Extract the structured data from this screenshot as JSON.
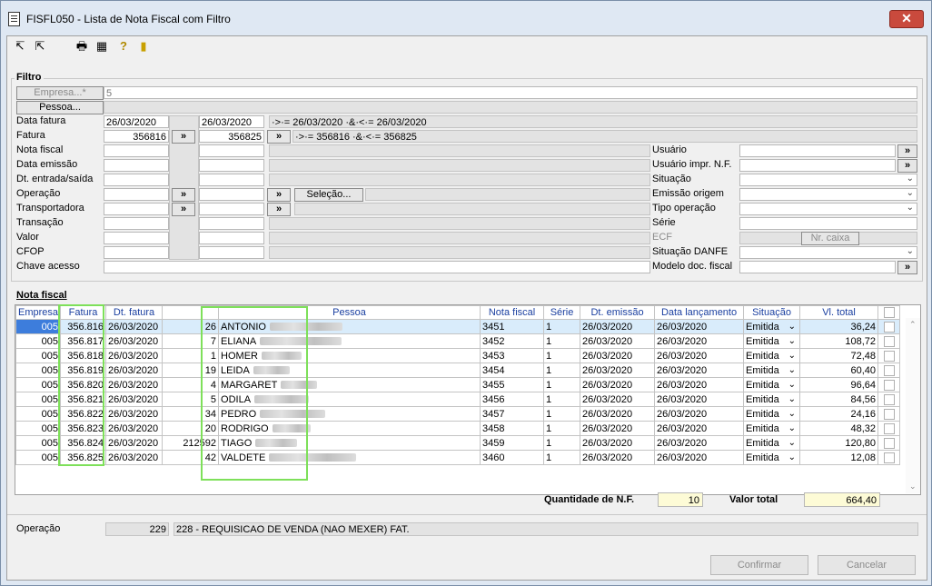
{
  "window": {
    "title": "FISFL050 - Lista de Nota Fiscal com Filtro",
    "close": "✕"
  },
  "toolbar": [
    "↸",
    "⇱",
    "🖶",
    "▦",
    "?",
    "▮"
  ],
  "filtro": {
    "title": "Filtro",
    "empresa_btn": "Empresa...*",
    "empresa_value": "5",
    "pessoa_btn": "Pessoa...",
    "data_fatura_label": "Data fatura",
    "data_fatura_from": "26/03/2020",
    "data_fatura_to": "26/03/2020",
    "data_fatura_expr": "·>·= 26/03/2020 ·&·<·= 26/03/2020",
    "fatura_label": "Fatura",
    "fatura_from": "356816",
    "fatura_to": "356825",
    "fatura_expr": "·>·= 356816 ·&·<·= 356825",
    "arrow": "»",
    "nota_fiscal_label": "Nota fiscal",
    "data_emissao_label": "Data emissão",
    "dt_entrada_label": "Dt. entrada/saída",
    "operacao_label": "Operação",
    "selecao_btn": "Seleção...",
    "transportadora_label": "Transportadora",
    "transacao_label": "Transação",
    "valor_label": "Valor",
    "cfop_label": "CFOP",
    "chave_label": "Chave acesso",
    "usuario_label": "Usuário",
    "usuario_impr_label": "Usuário impr. N.F.",
    "situacao_label": "Situação",
    "emissao_origem_label": "Emissão origem",
    "tipo_operacao_label": "Tipo operação",
    "serie_label": "Série",
    "ecf_label": "ECF",
    "nr_caixa_btn": "Nr. caixa",
    "situacao_danfe_label": "Situação DANFE",
    "modelo_label": "Modelo doc. fiscal"
  },
  "grid": {
    "title": "Nota fiscal",
    "headers": [
      "Empresa",
      "Fatura",
      "Dt. fatura",
      "",
      "Pessoa",
      "Nota fiscal",
      "Série",
      "Dt. emissão",
      "Data lançamento",
      "Situação",
      "Vl. total"
    ],
    "rows": [
      {
        "empresa": "005",
        "fatura": "356.816",
        "dt": "26/03/2020",
        "cod": "26",
        "pessoa": "ANTONIO",
        "nf": "3451",
        "serie": "1",
        "emissao": "26/03/2020",
        "lanc": "26/03/2020",
        "sit": "Emitida",
        "total": "36,24"
      },
      {
        "empresa": "005",
        "fatura": "356.817",
        "dt": "26/03/2020",
        "cod": "7",
        "pessoa": "ELIANA",
        "nf": "3452",
        "serie": "1",
        "emissao": "26/03/2020",
        "lanc": "26/03/2020",
        "sit": "Emitida",
        "total": "108,72"
      },
      {
        "empresa": "005",
        "fatura": "356.818",
        "dt": "26/03/2020",
        "cod": "1",
        "pessoa": "HOMER",
        "nf": "3453",
        "serie": "1",
        "emissao": "26/03/2020",
        "lanc": "26/03/2020",
        "sit": "Emitida",
        "total": "72,48"
      },
      {
        "empresa": "005",
        "fatura": "356.819",
        "dt": "26/03/2020",
        "cod": "19",
        "pessoa": "LEIDA",
        "nf": "3454",
        "serie": "1",
        "emissao": "26/03/2020",
        "lanc": "26/03/2020",
        "sit": "Emitida",
        "total": "60,40"
      },
      {
        "empresa": "005",
        "fatura": "356.820",
        "dt": "26/03/2020",
        "cod": "4",
        "pessoa": "MARGARET",
        "nf": "3455",
        "serie": "1",
        "emissao": "26/03/2020",
        "lanc": "26/03/2020",
        "sit": "Emitida",
        "total": "96,64"
      },
      {
        "empresa": "005",
        "fatura": "356.821",
        "dt": "26/03/2020",
        "cod": "5",
        "pessoa": "ODILA",
        "nf": "3456",
        "serie": "1",
        "emissao": "26/03/2020",
        "lanc": "26/03/2020",
        "sit": "Emitida",
        "total": "84,56"
      },
      {
        "empresa": "005",
        "fatura": "356.822",
        "dt": "26/03/2020",
        "cod": "34",
        "pessoa": "PEDRO",
        "nf": "3457",
        "serie": "1",
        "emissao": "26/03/2020",
        "lanc": "26/03/2020",
        "sit": "Emitida",
        "total": "24,16"
      },
      {
        "empresa": "005",
        "fatura": "356.823",
        "dt": "26/03/2020",
        "cod": "20",
        "pessoa": "RODRIGO",
        "nf": "3458",
        "serie": "1",
        "emissao": "26/03/2020",
        "lanc": "26/03/2020",
        "sit": "Emitida",
        "total": "48,32"
      },
      {
        "empresa": "005",
        "fatura": "356.824",
        "dt": "26/03/2020",
        "cod": "212592",
        "pessoa": "TIAGO",
        "nf": "3459",
        "serie": "1",
        "emissao": "26/03/2020",
        "lanc": "26/03/2020",
        "sit": "Emitida",
        "total": "120,80"
      },
      {
        "empresa": "005",
        "fatura": "356.825",
        "dt": "26/03/2020",
        "cod": "42",
        "pessoa": "VALDETE",
        "nf": "3460",
        "serie": "1",
        "emissao": "26/03/2020",
        "lanc": "26/03/2020",
        "sit": "Emitida",
        "total": "12,08"
      }
    ]
  },
  "summary": {
    "qtd_label": "Quantidade de N.F.",
    "qtd_value": "10",
    "valor_label": "Valor total",
    "valor_value": "664,40"
  },
  "footer": {
    "operacao_label": "Operação",
    "operacao_code": "229",
    "operacao_desc": "228 - REQUISICAO DE VENDA (NAO MEXER) FAT.",
    "confirmar": "Confirmar",
    "cancelar": "Cancelar"
  }
}
